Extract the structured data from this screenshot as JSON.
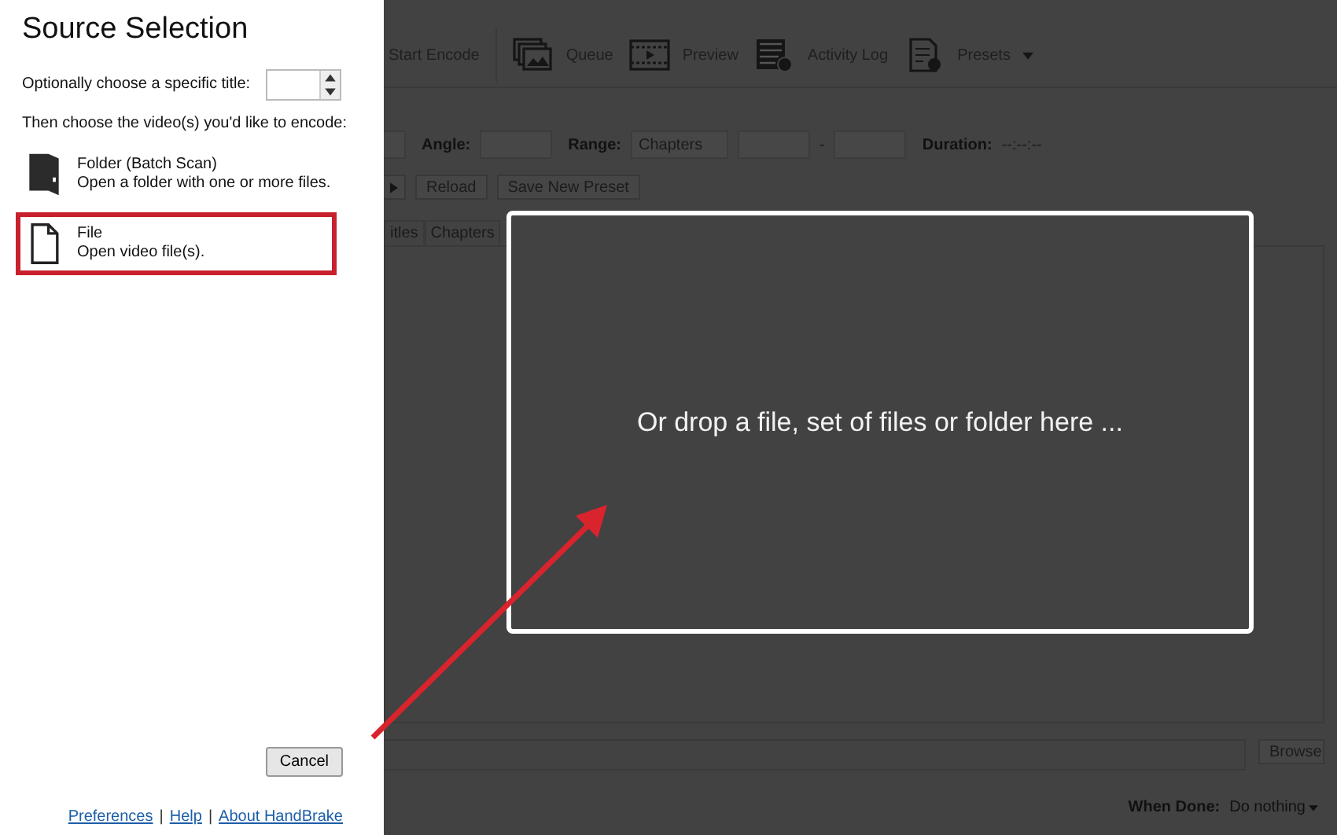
{
  "dialog": {
    "title": "Source Selection",
    "title_prompt": "Optionally choose a specific title:",
    "choose_prompt": "Then choose the video(s) you'd like to encode:",
    "options": [
      {
        "kind": "folder",
        "title": "Folder (Batch Scan)",
        "description": "Open a folder with one or more files.",
        "selected": false
      },
      {
        "kind": "file",
        "title": "File",
        "description": "Open video file(s).",
        "selected": true
      }
    ],
    "cancel_button": "Cancel",
    "links": [
      "Preferences",
      "Help",
      "About HandBrake"
    ],
    "link_separator": "|"
  },
  "main": {
    "toolbar": [
      {
        "kind": "text",
        "label": "Start Encode"
      },
      {
        "kind": "queue",
        "label": "Queue"
      },
      {
        "kind": "preview",
        "label": "Preview"
      },
      {
        "kind": "log",
        "label": "Activity Log"
      },
      {
        "kind": "presets",
        "label": "Presets"
      }
    ],
    "source_row": {
      "angle_label": "Angle:",
      "range_label": "Range:",
      "range_value": "Chapters",
      "range_dash": "-",
      "duration_label": "Duration:",
      "duration_value": "--:--:--"
    },
    "preset_buttons": [
      "Reload",
      "Save New Preset"
    ],
    "tabs": [
      {
        "label": "itles"
      },
      {
        "label": "Chapters"
      }
    ],
    "browse_button": "Browse",
    "when_done_label": "When Done:",
    "when_done_value": "Do nothing",
    "drop_zone": "Or drop a file, set of files or folder here ..."
  }
}
